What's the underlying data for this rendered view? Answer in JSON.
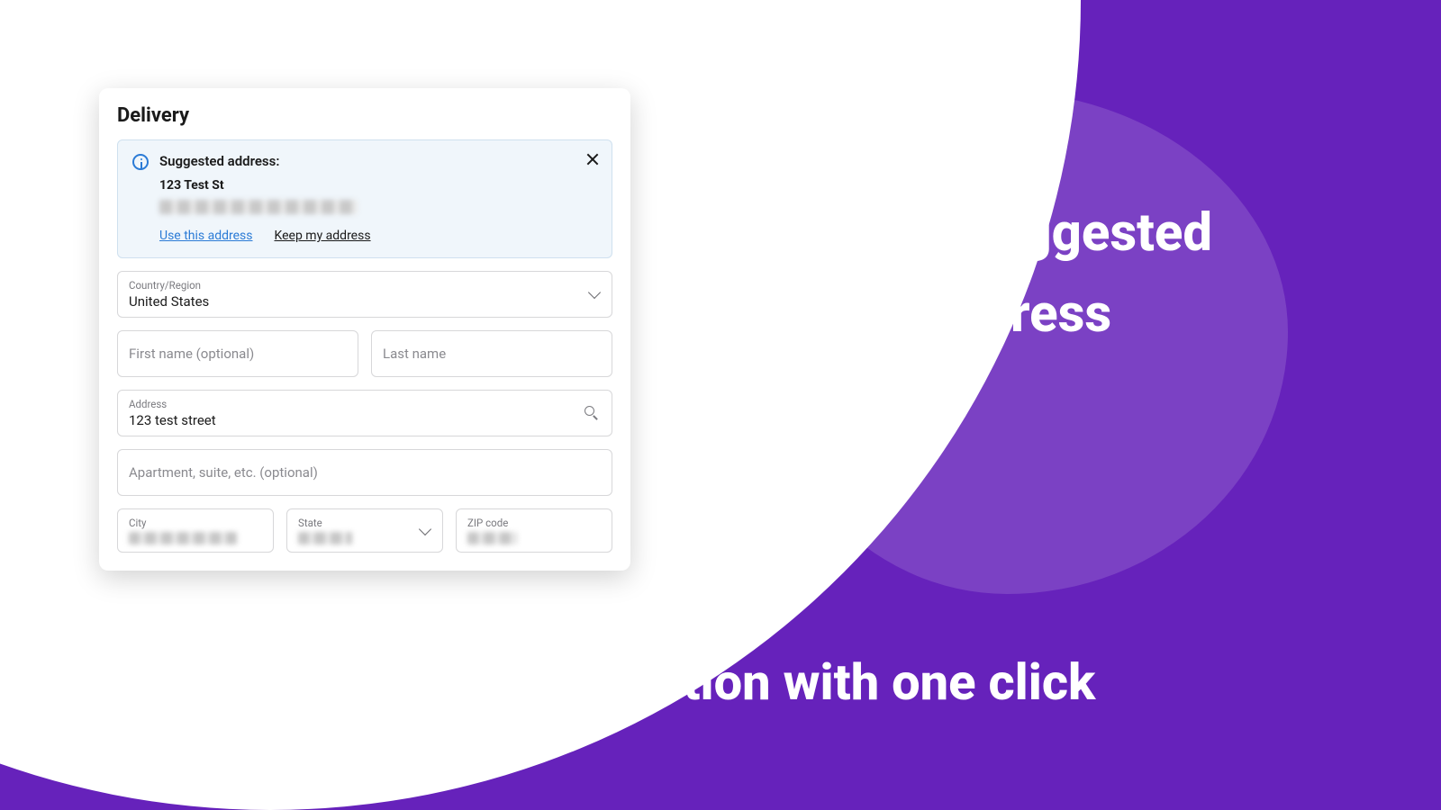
{
  "marketing": {
    "right_headline": "Show suggested address",
    "bottom_headline": "Accept suggestion with one click"
  },
  "card": {
    "title": "Delivery",
    "suggestion": {
      "label": "Suggested address:",
      "line1": "123 Test St",
      "use_link": "Use this address",
      "keep_link": "Keep my address"
    },
    "country": {
      "label": "Country/Region",
      "value": "United States"
    },
    "first_name_placeholder": "First name (optional)",
    "last_name_placeholder": "Last name",
    "address": {
      "label": "Address",
      "value": "123 test street"
    },
    "apt_placeholder": "Apartment, suite, etc. (optional)",
    "city_label": "City",
    "state_label": "State",
    "zip_label": "ZIP code"
  }
}
